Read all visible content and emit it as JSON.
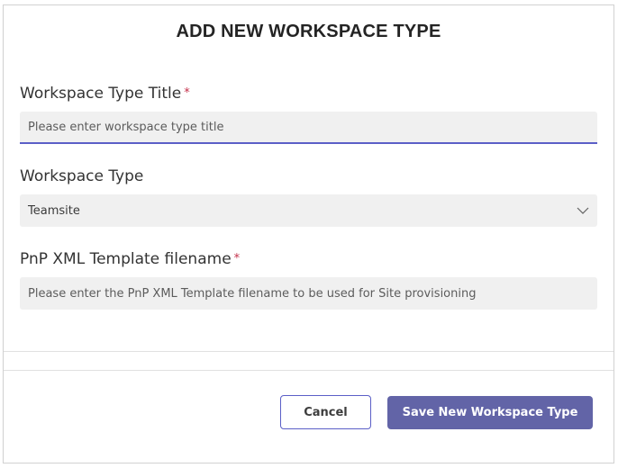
{
  "dialog": {
    "title": "ADD NEW WORKSPACE TYPE"
  },
  "form": {
    "title_field": {
      "label": "Workspace Type Title",
      "required_marker": "*",
      "value": "",
      "placeholder": "Please enter workspace type title"
    },
    "type_field": {
      "label": "Workspace Type",
      "selected": "Teamsite"
    },
    "template_field": {
      "label": "PnP XML Template filename",
      "required_marker": "*",
      "value": "",
      "placeholder": "Please enter the PnP XML Template filename to be used for Site provisioning"
    }
  },
  "footer": {
    "cancel_label": "Cancel",
    "save_label": "Save New Workspace Type"
  },
  "colors": {
    "accent": "#5b5fc7",
    "primary_button": "#6264a7",
    "required": "#c4314b",
    "field_bg": "#f0f0f0"
  },
  "icons": {
    "select_arrow": "chevron-down-icon"
  }
}
